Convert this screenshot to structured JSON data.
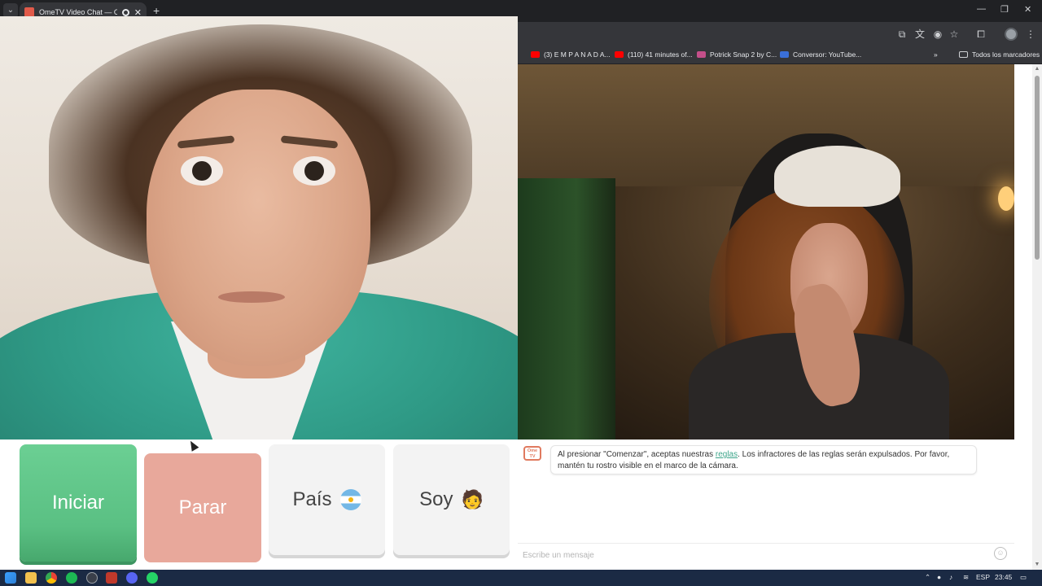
{
  "browser": {
    "tab": {
      "title": "OmeTV Video Chat — Ome",
      "close": "✕"
    },
    "new_tab": "+",
    "tab_list": "⌄",
    "window_controls": {
      "minimize": "—",
      "restore": "❐",
      "close": "✕"
    },
    "toolbar_icons": [
      "screen-cast-icon",
      "translate-icon",
      "eye-off-icon",
      "star-icon",
      "extensions-icon",
      "profile-icon",
      "menu-icon"
    ],
    "bookmarks": [
      {
        "label": "(3) E M P A N A D A...",
        "icon": "youtube-icon",
        "color": "#ff0000"
      },
      {
        "label": "(110) 41 minutes of...",
        "icon": "youtube-icon",
        "color": "#ff0000"
      },
      {
        "label": "Potrick Snap 2 by C...",
        "icon": "image-icon",
        "color": "#c44f8a"
      },
      {
        "label": "Conversor: YouTube...",
        "icon": "converter-icon",
        "color": "#3a6fd8"
      }
    ],
    "bookmarks_overflow": "»",
    "all_bookmarks": "Todos los marcadores"
  },
  "controls": {
    "start_label": "Iniciar",
    "stop_label": "Parar",
    "country_label": "País",
    "country_flag": "argentina-flag-icon",
    "gender_label": "Soy",
    "gender_icon": "🧑",
    "colors": {
      "start": "#5ac083",
      "stop": "#e8a89b",
      "neutral": "#f3f3f3"
    }
  },
  "chat": {
    "logo_line1": "Ome",
    "logo_line2": "TV",
    "message_prefix": "Al presionar \"Comenzar\", aceptas nuestras ",
    "message_link": "reglas",
    "message_suffix": ". Los infractores de las reglas serán expulsados. Por favor, mantén tu rostro visible en el marco de la cámara.",
    "input_placeholder": "Escribe un mensaje",
    "emoji_icon": "smiley-icon"
  },
  "taskbar": {
    "language": "ESP",
    "time": "23:45"
  }
}
